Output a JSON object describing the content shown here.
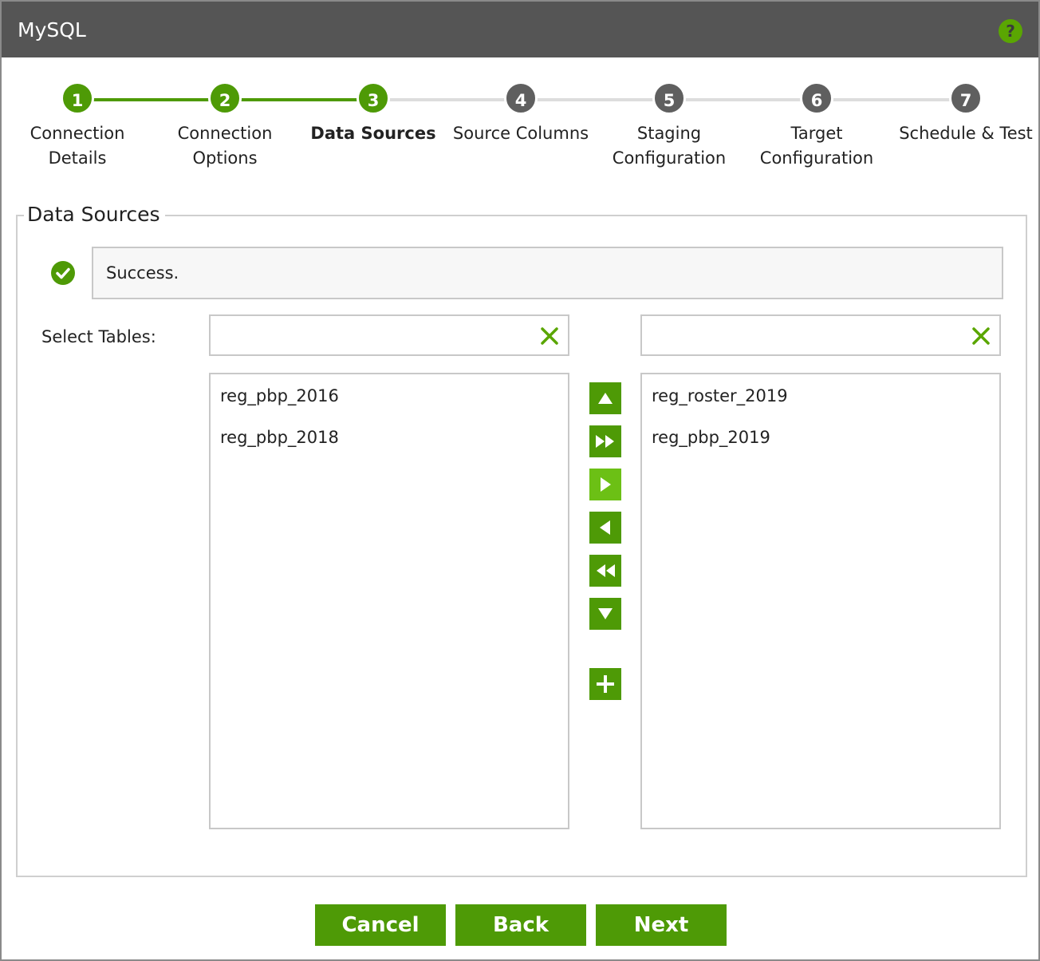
{
  "window": {
    "title": "MySQL",
    "help_icon": "?"
  },
  "steps": [
    {
      "number": "1",
      "label_line1": "Connection",
      "label_line2": "Details",
      "state": "done"
    },
    {
      "number": "2",
      "label_line1": "Connection",
      "label_line2": "Options",
      "state": "done"
    },
    {
      "number": "3",
      "label_line1": "Data Sources",
      "label_line2": "",
      "state": "active"
    },
    {
      "number": "4",
      "label_line1": "Source Columns",
      "label_line2": "",
      "state": "todo"
    },
    {
      "number": "5",
      "label_line1": "Staging",
      "label_line2": "Configuration",
      "state": "todo"
    },
    {
      "number": "6",
      "label_line1": "Target",
      "label_line2": "Configuration",
      "state": "todo"
    },
    {
      "number": "7",
      "label_line1": "Schedule & Test",
      "label_line2": "",
      "state": "todo"
    }
  ],
  "section": {
    "legend": "Data Sources",
    "status_message": "Success.",
    "select_label": "Select Tables:",
    "left_filter": {
      "value": ""
    },
    "right_filter": {
      "value": ""
    },
    "available_tables": [
      "reg_pbp_2016",
      "reg_pbp_2018"
    ],
    "selected_tables": [
      "reg_roster_2019",
      "reg_pbp_2019"
    ]
  },
  "icons": {
    "status": "check-circle-icon",
    "clear": "x-icon",
    "movers": [
      "move-up-icon",
      "move-all-right-icon",
      "move-right-icon",
      "move-left-icon",
      "move-all-left-icon",
      "move-down-icon",
      "add-icon"
    ]
  },
  "footer": {
    "cancel_label": "Cancel",
    "back_label": "Back",
    "next_label": "Next"
  },
  "colors": {
    "accent": "#4e9a06",
    "titlebar": "#555555",
    "step_inactive": "#5f5f5f",
    "highlight": "#6cc015"
  }
}
